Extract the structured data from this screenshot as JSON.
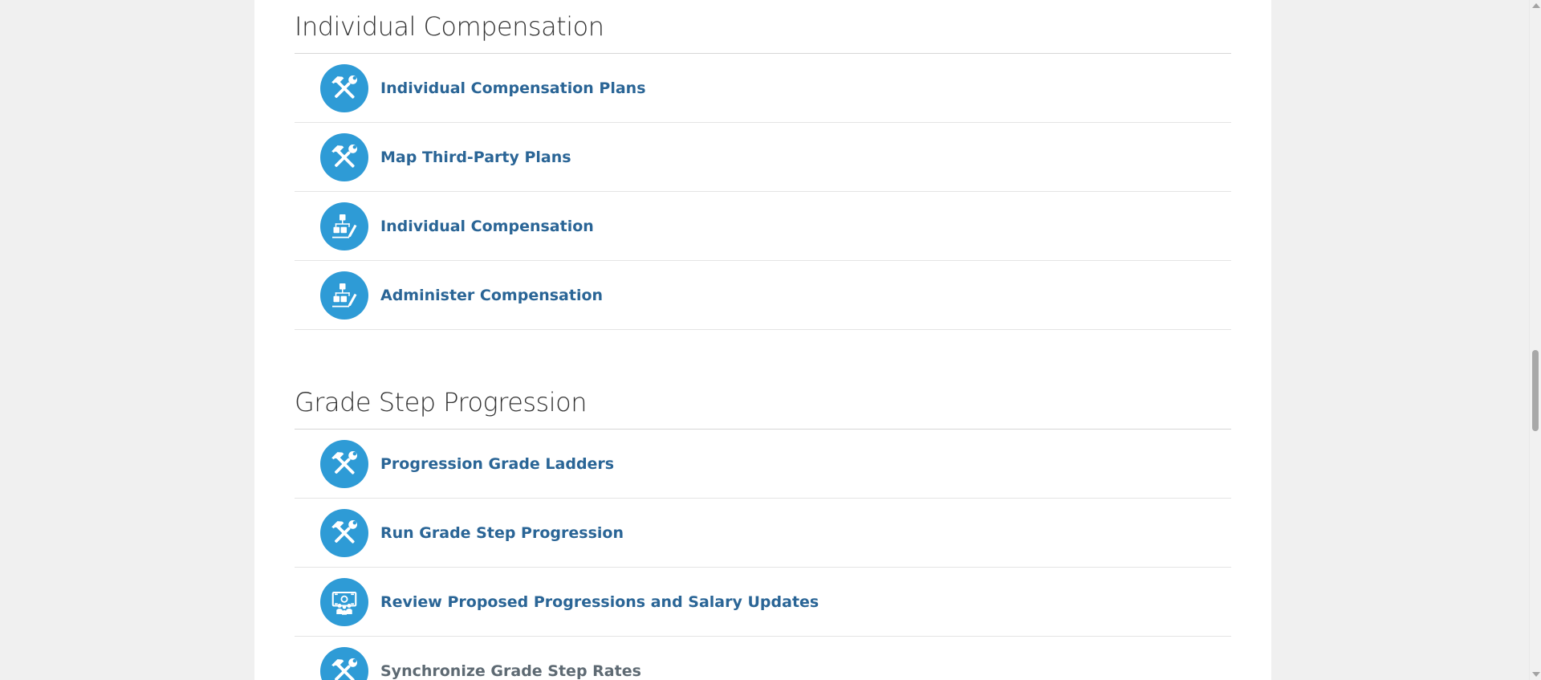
{
  "sections": [
    {
      "title": "Individual Compensation",
      "items": [
        {
          "label": "Individual Compensation Plans",
          "icon": "tools-icon"
        },
        {
          "label": "Map Third-Party Plans",
          "icon": "tools-icon"
        },
        {
          "label": "Individual Compensation",
          "icon": "hierarchy-edit-icon"
        },
        {
          "label": "Administer Compensation",
          "icon": "hierarchy-edit-icon"
        }
      ]
    },
    {
      "title": "Grade Step Progression",
      "items": [
        {
          "label": "Progression Grade Ladders",
          "icon": "tools-icon"
        },
        {
          "label": "Run Grade Step Progression",
          "icon": "tools-icon"
        },
        {
          "label": "Review Proposed Progressions and Salary Updates",
          "icon": "salary-review-icon"
        },
        {
          "label": "Synchronize Grade Step Rates",
          "icon": "tools-icon"
        }
      ]
    }
  ],
  "colors": {
    "icon_bg": "#2e9bd6",
    "link": "#2a6596",
    "heading": "#333333",
    "page_bg": "#f0f0f0"
  }
}
